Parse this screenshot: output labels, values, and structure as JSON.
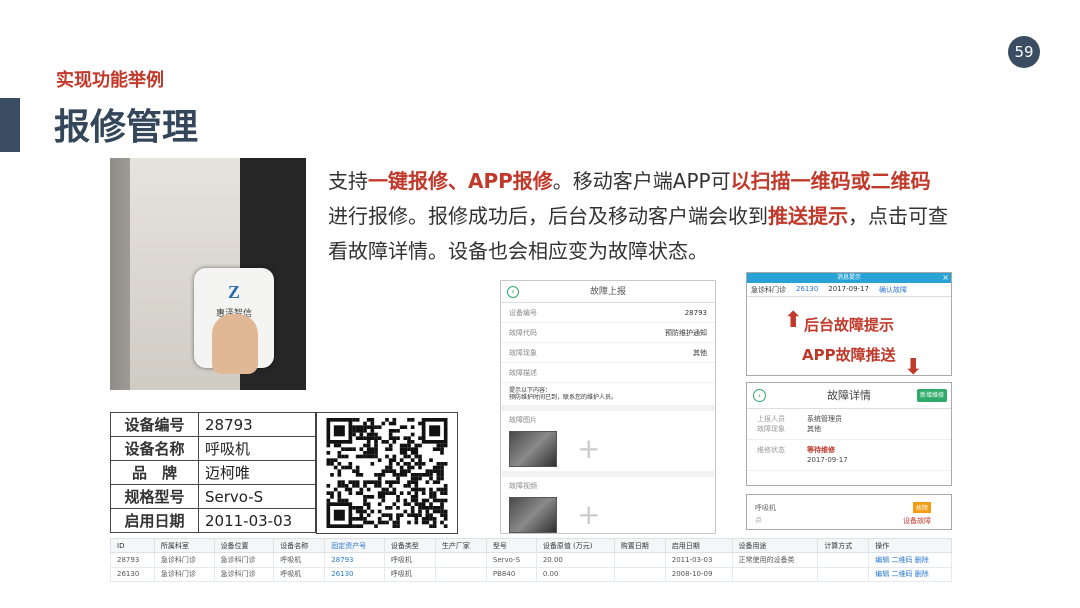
{
  "page_number": "59",
  "subtitle": "实现功能举例",
  "title": "报修管理",
  "photo": {
    "brand": "惠泽智信"
  },
  "description": {
    "p1": "支持",
    "p2": "一键报修、APP报修",
    "p3": "。移动客户端APP可",
    "p4": "以扫描一维码或二维码",
    "p5": "进行报修。报修成功后，后台及移动客户端会收到",
    "p6": "推送提示",
    "p7": "，点击可查看故障详情。设备也会相应变为故障状态。"
  },
  "info_table": [
    {
      "k": "设备编号",
      "v": "28793"
    },
    {
      "k": "设备名称",
      "v": "呼吸机"
    },
    {
      "k": "品　牌",
      "v": "迈柯唯"
    },
    {
      "k": "规格型号",
      "v": "Servo-S"
    },
    {
      "k": "启用日期",
      "v": "2011-03-03"
    }
  ],
  "phone": {
    "title": "故障上报",
    "rows": [
      {
        "k": "设备编号",
        "v": "28793"
      },
      {
        "k": "故障代码",
        "v": "预防维护通知"
      },
      {
        "k": "故障现象",
        "v": "其他"
      },
      {
        "k": "故障描述",
        "v": ""
      }
    ],
    "note1": "提示以下内容：",
    "note2": "预防维护时间已到，联系您的维护人员。",
    "image_section": "故障图片",
    "video_section": "故障视频"
  },
  "alert_panel": {
    "bar": "消息提示",
    "dept": "急诊科门诊",
    "id": "26130",
    "date": "2017-09-17",
    "action": "确认故障",
    "callout1": "后台故障提示",
    "callout2": "APP故障推送"
  },
  "detail_panel": {
    "title": "故障详情",
    "new_btn": "新增维修",
    "reporter_k": "上报人员",
    "reporter_v": "系统管理员",
    "category_k": "故障现象",
    "category_v": "其他",
    "status_k": "维修状态",
    "status_v": "等待维修",
    "status_date": "2017-09-17"
  },
  "device_panel": {
    "name": "呼吸机",
    "sub": "点",
    "badge": "故障",
    "status": "设备故障"
  },
  "grid": {
    "headers": [
      "ID",
      "所属科室",
      "设备位置",
      "设备名称",
      "固定资产号",
      "设备类型",
      "生产厂家",
      "型号",
      "设备原值 (万元)",
      "购置日期",
      "启用日期",
      "设备用途",
      "计算方式",
      "操作"
    ],
    "rows": [
      [
        "28793",
        "急诊科门诊",
        "急诊科门诊",
        "呼吸机",
        "28793",
        "呼吸机",
        "",
        "Servo-S",
        "20.00",
        "",
        "2011-03-03",
        "正常使用的设备类",
        "",
        "编辑 二维码 删除"
      ],
      [
        "26130",
        "急诊科门诊",
        "急诊科门诊",
        "呼吸机",
        "26130",
        "呼吸机",
        "",
        "PB840",
        "0.00",
        "",
        "2008-10-09",
        "",
        "",
        "编辑 二维码 删除"
      ]
    ]
  },
  "colors": {
    "accent_dark": "#3b4d63",
    "highlight_red": "#c0392b",
    "link_blue": "#2a7ad0",
    "green": "#2eaa6a"
  }
}
